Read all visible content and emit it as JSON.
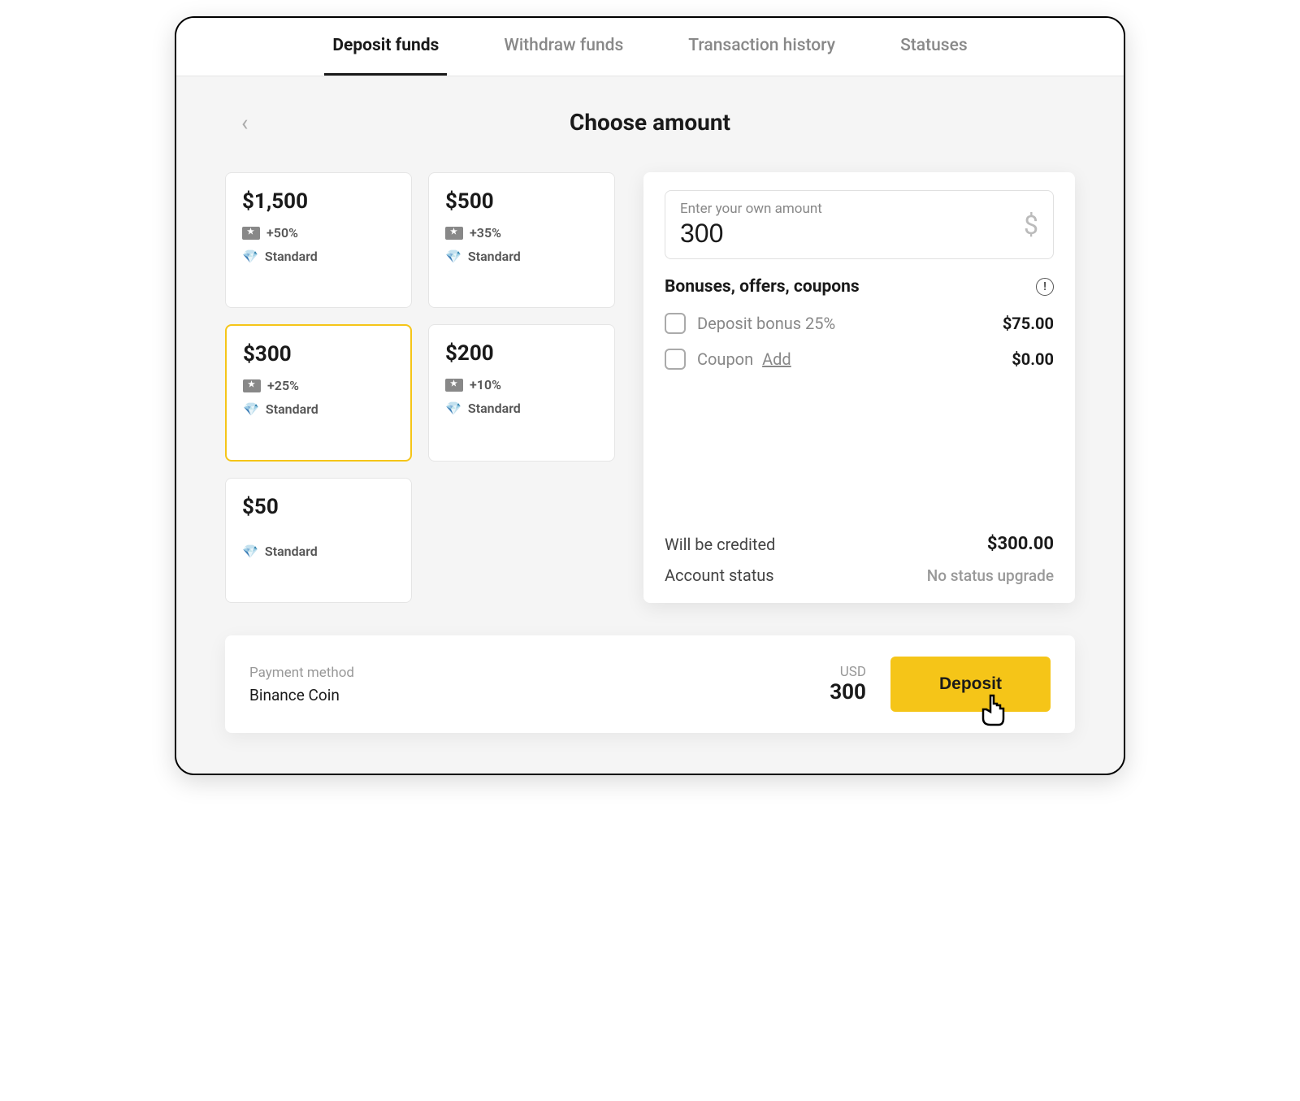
{
  "tabs": {
    "deposit": "Deposit funds",
    "withdraw": "Withdraw funds",
    "history": "Transaction history",
    "statuses": "Statuses"
  },
  "page_title": "Choose amount",
  "presets": [
    {
      "amount": "$1,500",
      "bonus": "+50%",
      "tier": "Standard"
    },
    {
      "amount": "$500",
      "bonus": "+35%",
      "tier": "Standard"
    },
    {
      "amount": "$300",
      "bonus": "+25%",
      "tier": "Standard"
    },
    {
      "amount": "$200",
      "bonus": "+10%",
      "tier": "Standard"
    },
    {
      "amount": "$50",
      "bonus": null,
      "tier": "Standard"
    }
  ],
  "input": {
    "label": "Enter your own amount",
    "value": "300",
    "currency": "$"
  },
  "bonuses": {
    "title": "Bonuses, offers, coupons",
    "deposit_bonus_label": "Deposit bonus 25%",
    "deposit_bonus_value": "$75.00",
    "coupon_label": "Coupon",
    "coupon_add": "Add",
    "coupon_value": "$0.00"
  },
  "summary": {
    "credited_label": "Will be credited",
    "credited_value": "$300.00",
    "status_label": "Account status",
    "status_value": "No status upgrade"
  },
  "footer": {
    "pm_label": "Payment method",
    "pm_value": "Binance Coin",
    "currency": "USD",
    "amount": "300",
    "button": "Deposit"
  }
}
